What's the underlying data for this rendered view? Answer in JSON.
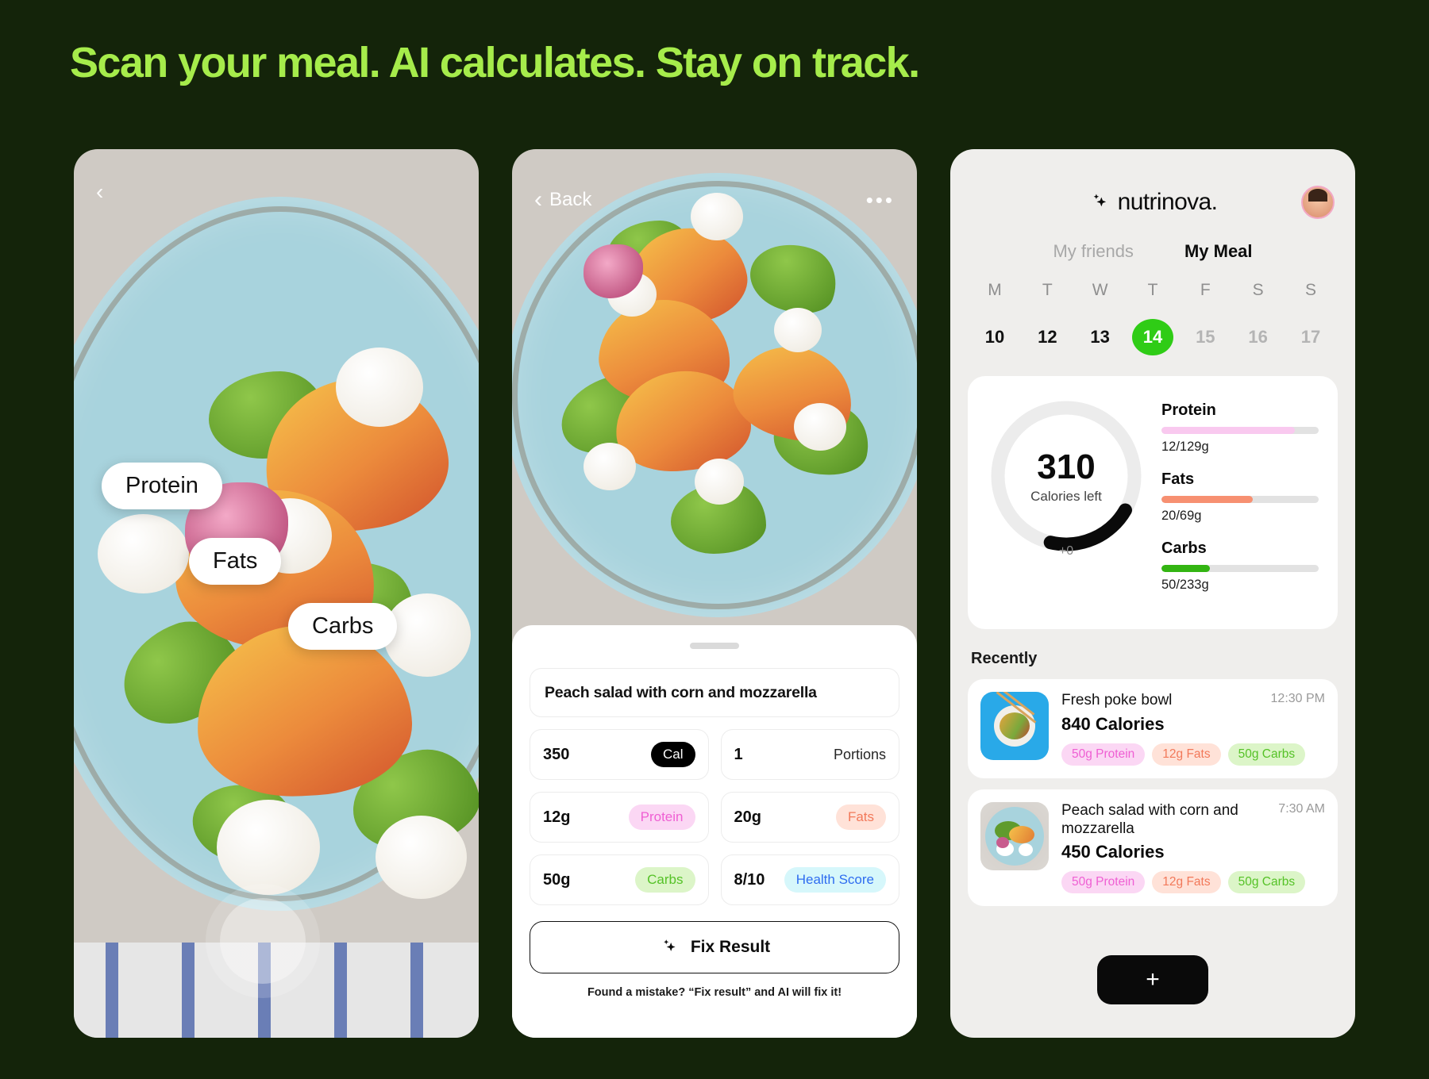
{
  "headline": "Scan your meal. AI calculates. Stay on track.",
  "theme": {
    "bg": "#14240a",
    "accent": "#a6ec4b",
    "green": "#2fcc16"
  },
  "scan_screen": {
    "back_icon": "‹",
    "tags": [
      {
        "label": "Protein"
      },
      {
        "label": "Fats"
      },
      {
        "label": "Carbs"
      }
    ],
    "shutter_label": ""
  },
  "result_screen": {
    "back_label": "Back",
    "back_icon": "‹",
    "more_icon": "•••",
    "meal_name": "Peach salad with corn and mozzarella",
    "tiles": [
      {
        "value": "350",
        "badge": "Cal",
        "badge_style": "b-cal"
      },
      {
        "value": "1",
        "badge": "Portions",
        "badge_style": "plain"
      },
      {
        "value": "12g",
        "badge": "Protein",
        "badge_style": "b-protein"
      },
      {
        "value": "20g",
        "badge": "Fats",
        "badge_style": "b-fats"
      },
      {
        "value": "50g",
        "badge": "Carbs",
        "badge_style": "b-carbs"
      },
      {
        "value": "8/10",
        "badge": "Health Score",
        "badge_style": "b-health"
      }
    ],
    "fix_button": "Fix Result",
    "fix_icon": "sparkle-icon",
    "fix_note": "Found a mistake? “Fix result” and AI will fix it!"
  },
  "home_screen": {
    "brand": "nutrinova.",
    "brand_icon": "sparkle-icon",
    "avatar": "user-avatar",
    "tabs": [
      {
        "label": "My friends",
        "active": false
      },
      {
        "label": "My Meal",
        "active": true
      }
    ],
    "calendar": {
      "daynames": [
        "M",
        "T",
        "W",
        "T",
        "F",
        "S",
        "S"
      ],
      "days": [
        {
          "num": "10",
          "state": "dim"
        },
        {
          "num": "12",
          "state": "dim"
        },
        {
          "num": "13",
          "state": "dim"
        },
        {
          "num": "14",
          "state": "sel"
        },
        {
          "num": "15",
          "state": "muted"
        },
        {
          "num": "16",
          "state": "muted"
        },
        {
          "num": "17",
          "state": "muted"
        }
      ]
    },
    "summary": {
      "calories_left": "310",
      "calories_label": "Calories left",
      "plus_zero": "+0",
      "macros": [
        {
          "name": "Protein",
          "value": "12/129g",
          "pct": 85,
          "color": "#f9c9ef"
        },
        {
          "name": "Fats",
          "value": "20/69g",
          "pct": 58,
          "color": "#f79071"
        },
        {
          "name": "Carbs",
          "value": "50/233g",
          "pct": 31,
          "color": "#33b512"
        }
      ]
    },
    "recently_label": "Recently",
    "meals": [
      {
        "title": "Fresh poke bowl",
        "time": "12:30 PM",
        "calories": "840 Calories",
        "chips": [
          {
            "label": "50g Protein",
            "style": "b-protein"
          },
          {
            "label": "12g Fats",
            "style": "b-fats"
          },
          {
            "label": "50g Carbs",
            "style": "b-carbs"
          }
        ]
      },
      {
        "title": "Peach salad with corn and mozzarella",
        "time": "7:30 AM",
        "calories": "450 Calories",
        "chips": [
          {
            "label": "50g Protein",
            "style": "b-protein"
          },
          {
            "label": "12g Fats",
            "style": "b-fats"
          },
          {
            "label": "50g Carbs",
            "style": "b-carbs"
          }
        ]
      }
    ],
    "add_button": "+"
  }
}
